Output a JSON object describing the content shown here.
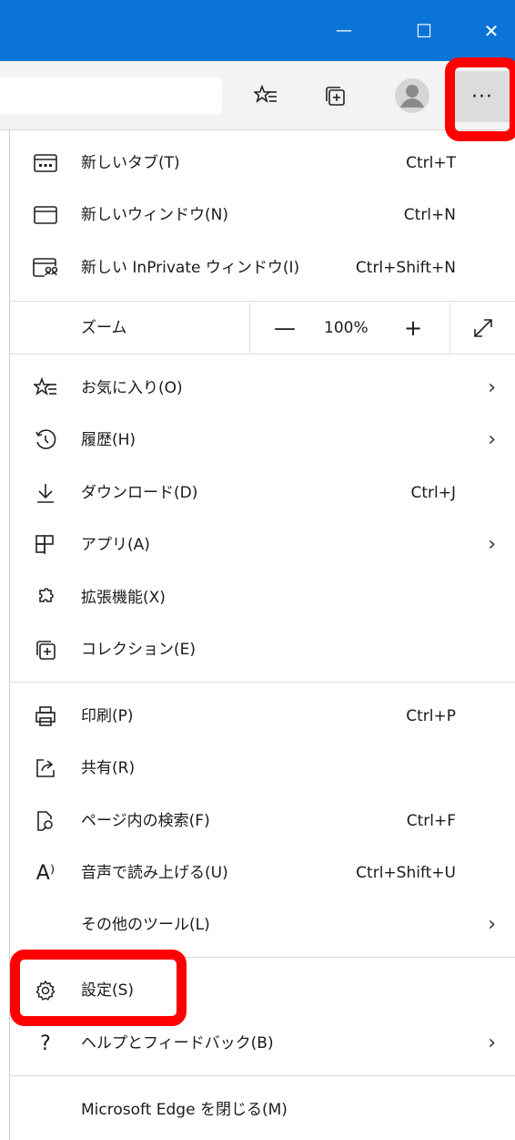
{
  "window_controls": {
    "minimize": "—",
    "maximize": "☐",
    "close": "✕"
  },
  "toolbar": {
    "more_label": "···"
  },
  "menu": {
    "items": [
      {
        "label": "新しいタブ(T)",
        "shortcut": "Ctrl+T",
        "icon": "new-tab-icon"
      },
      {
        "label": "新しいウィンドウ(N)",
        "shortcut": "Ctrl+N",
        "icon": "new-window-icon"
      },
      {
        "label": "新しい InPrivate ウィンドウ(I)",
        "shortcut": "Ctrl+Shift+N",
        "icon": "inprivate-icon"
      },
      {
        "label": "お気に入り(O)",
        "shortcut": "",
        "icon": "favorites-icon",
        "submenu": true
      },
      {
        "label": "履歴(H)",
        "shortcut": "",
        "icon": "history-icon",
        "submenu": true
      },
      {
        "label": "ダウンロード(D)",
        "shortcut": "Ctrl+J",
        "icon": "download-icon"
      },
      {
        "label": "アプリ(A)",
        "shortcut": "",
        "icon": "apps-icon",
        "submenu": true
      },
      {
        "label": "拡張機能(X)",
        "shortcut": "",
        "icon": "extensions-icon"
      },
      {
        "label": "コレクション(E)",
        "shortcut": "",
        "icon": "collections-icon"
      },
      {
        "label": "印刷(P)",
        "shortcut": "Ctrl+P",
        "icon": "print-icon"
      },
      {
        "label": "共有(R)",
        "shortcut": "",
        "icon": "share-icon"
      },
      {
        "label": "ページ内の検索(F)",
        "shortcut": "Ctrl+F",
        "icon": "find-icon"
      },
      {
        "label": "音声で読み上げる(U)",
        "shortcut": "Ctrl+Shift+U",
        "icon": "read-aloud-icon",
        "icon_text": "A⁾"
      },
      {
        "label": "その他のツール(L)",
        "shortcut": "",
        "icon": "",
        "submenu": true
      },
      {
        "label": "設定(S)",
        "shortcut": "",
        "icon": "gear-icon"
      },
      {
        "label": "ヘルプとフィードバック(B)",
        "shortcut": "",
        "icon": "help-icon",
        "icon_text": "?",
        "submenu": true
      },
      {
        "label": "Microsoft Edge を閉じる(M)",
        "shortcut": "",
        "icon": ""
      }
    ],
    "zoom": {
      "label": "ズーム",
      "minus": "—",
      "value": "100%",
      "plus": "+"
    },
    "submenu_arrow": "›"
  },
  "colors": {
    "titlebar": "#0a74d8",
    "highlight": "#ff0000"
  }
}
